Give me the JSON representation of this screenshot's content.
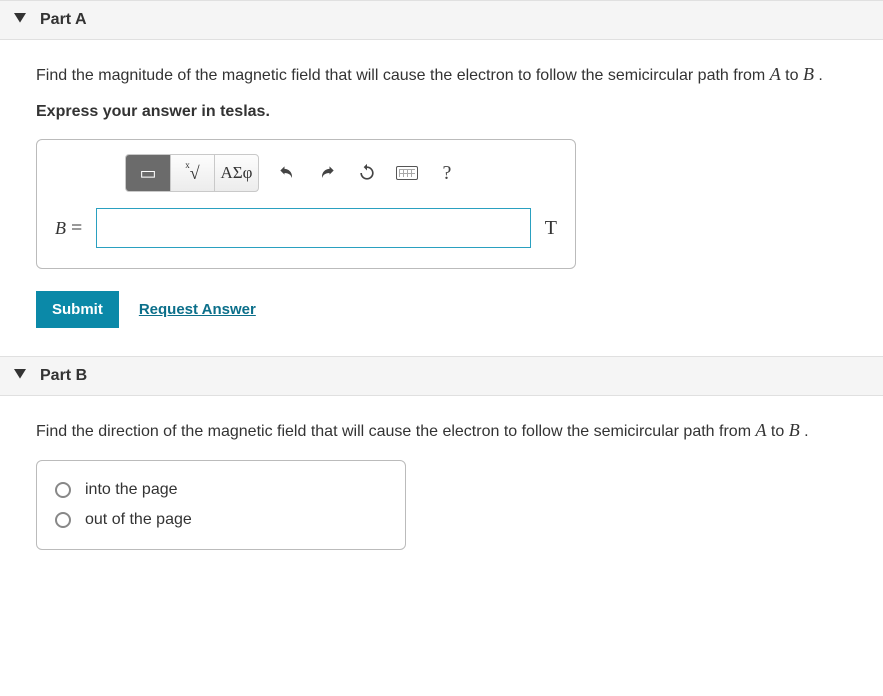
{
  "partA": {
    "title": "Part A",
    "problem_pre": "Find the magnitude of the magnetic field that will cause the electron to follow the semicircular path from ",
    "problem_mid": " to ",
    "problem_end": ".",
    "varA": "A",
    "varB": "B",
    "express": "Express your answer in teslas.",
    "toolbar": {
      "template": "▭",
      "nthroot": "√",
      "greek": "ΑΣφ",
      "undo": "↶",
      "redo": "↷",
      "reset": "↻",
      "help": "?"
    },
    "var_label": "B =",
    "answer_value": "",
    "unit": "T",
    "submit": "Submit",
    "request": "Request Answer"
  },
  "partB": {
    "title": "Part B",
    "problem_pre": "Find the direction of the magnetic field that will cause the electron to follow the semicircular path from ",
    "problem_mid": " to ",
    "problem_end": ".",
    "varA": "A",
    "varB": "B",
    "options": {
      "opt1": "into the page",
      "opt2": "out of the page"
    }
  }
}
